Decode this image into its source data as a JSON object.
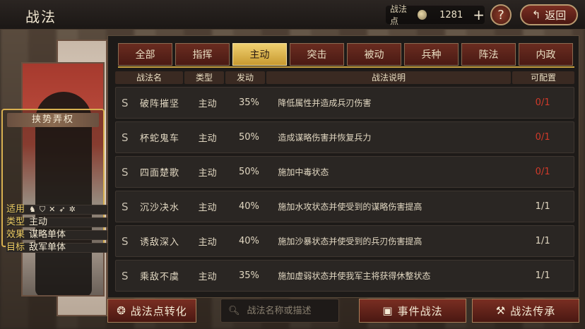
{
  "header": {
    "title": "战法",
    "points_label": "战法点",
    "points_value": "1281",
    "plus": "+",
    "help": "?",
    "back_label": "返回"
  },
  "card": {
    "title": "挟势弄权",
    "apply_label": "适用",
    "type_label": "类型",
    "type_value": "主动",
    "effect_label": "效果",
    "effect_value": "谋略单体",
    "target_label": "目标",
    "target_value": "敌军单体"
  },
  "tabs": [
    "全部",
    "指挥",
    "主动",
    "突击",
    "被动",
    "兵种",
    "阵法",
    "内政"
  ],
  "active_tab": 2,
  "columns": [
    "战法名",
    "类型",
    "发动",
    "战法说明",
    "可配置"
  ],
  "rows": [
    {
      "grade": "S",
      "name": "破阵摧坚",
      "type": "主动",
      "rate": "35%",
      "desc": "降低属性并造成兵刃伤害",
      "cfg": "0/1",
      "full": true
    },
    {
      "grade": "S",
      "name": "杯蛇鬼车",
      "type": "主动",
      "rate": "50%",
      "desc": "造成谋略伤害并恢复兵力",
      "cfg": "0/1",
      "full": true
    },
    {
      "grade": "S",
      "name": "四面楚歌",
      "type": "主动",
      "rate": "50%",
      "desc": "施加中毒状态",
      "cfg": "0/1",
      "full": true
    },
    {
      "grade": "S",
      "name": "沉沙决水",
      "type": "主动",
      "rate": "40%",
      "desc": "施加水攻状态并使受到的谋略伤害提高",
      "cfg": "1/1",
      "full": false
    },
    {
      "grade": "S",
      "name": "诱敌深入",
      "type": "主动",
      "rate": "40%",
      "desc": "施加沙暴状态并使受到的兵刃伤害提高",
      "cfg": "1/1",
      "full": false
    },
    {
      "grade": "S",
      "name": "乘敌不虞",
      "type": "主动",
      "rate": "35%",
      "desc": "施加虚弱状态并使我军主将获得休整状态",
      "cfg": "1/1",
      "full": false
    }
  ],
  "bottom": {
    "convert_label": "战法点转化",
    "search_placeholder": "战法名称或描述",
    "event_label": "事件战法",
    "inherit_label": "战法传承"
  },
  "colors": {
    "accent": "#f0d070",
    "full": "#d03a2a"
  }
}
